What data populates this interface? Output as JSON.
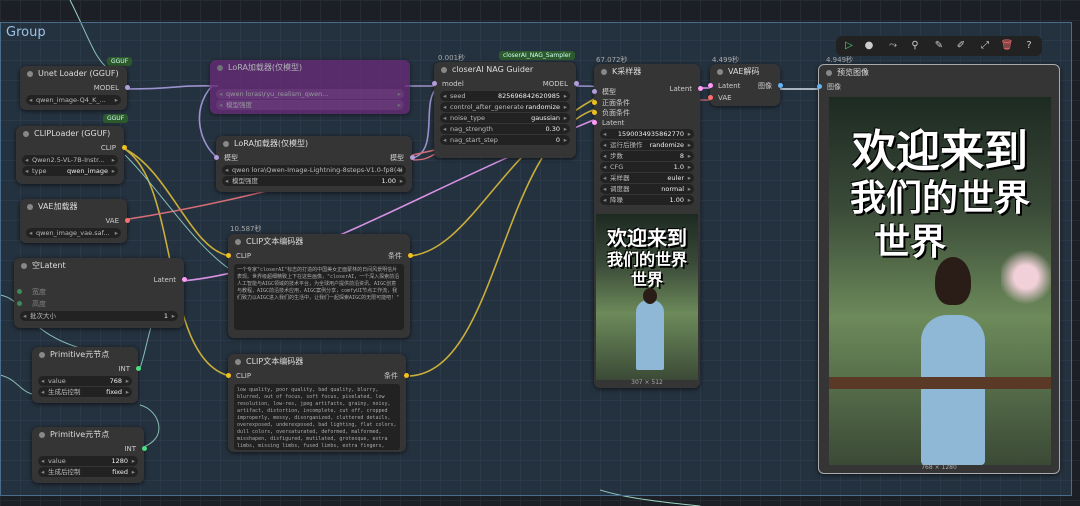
{
  "group": {
    "title": "Group"
  },
  "toolbar": {
    "icons": [
      "play-icon",
      "color-icon",
      "bypass-icon",
      "pin-icon",
      "edit-icon",
      "pen-icon",
      "fit-icon",
      "trash-icon",
      "help-icon"
    ]
  },
  "unet": {
    "badge": "GGUF",
    "title": "Unet Loader (GGUF)",
    "out": "MODEL",
    "value": "qwen_image-Q4_K_..."
  },
  "clip_loader": {
    "badge": "GGUF",
    "title": "CLIPLoader (GGUF)",
    "out": "CLIP",
    "value1": "Qwen2.5-VL-7B-Instr...",
    "type_label": "type",
    "type_value": "qwen_image"
  },
  "vae_loader": {
    "title": "VAE加载器",
    "out": "VAE",
    "value": "qwen_image_vae.saf..."
  },
  "latent": {
    "title": "空Latent",
    "out": "Latent",
    "w_label": "宽度",
    "h_label": "高度",
    "batch_label": "批次大小",
    "batch_value": "1"
  },
  "prim1": {
    "title": "Primitive元节点",
    "out": "INT",
    "value_label": "value",
    "value": "768",
    "ctrl_label": "生成后控制",
    "ctrl_value": "fixed"
  },
  "prim2": {
    "title": "Primitive元节点",
    "out": "INT",
    "value_label": "value",
    "value": "1280",
    "ctrl_label": "生成后控制",
    "ctrl_value": "fixed"
  },
  "lora_bypass": {
    "title": "LoRA加载器(仅模型)",
    "in": "模型",
    "out": "模型",
    "lora_value": "qwen lora\\Qwen-Image-Lightning-8steps-V1.0-fp8(4(2...",
    "strength_label": "模型强度",
    "strength_value": "1.00"
  },
  "lora_top": {
    "title": "LoRA加载器(仅模型)",
    "value": "qwen loras\\ryu_realism_qwen...",
    "label": "模型强度"
  },
  "clip_pos": {
    "time": "10.587秒",
    "title": "CLIP文本编码器",
    "in": "CLIP",
    "out": "条件",
    "text": "一个专家\"closerAI\"标志的打造的中国美女正面蒙林的日间风景明信片表现。世界级超细精致上下在这些画像，\"closerAI，一个深入探索前沿人工智能与AIGC领域的技术平台，为全球用户提供前沿资讯、AIGC创意与教程，AIGC前沿技术应用，AIGC案例分享，comfyUI节点工作流，我们致力以AIGC进入我们的生活中，让我们一起探索AIGC的无限可能吧！\""
  },
  "clip_neg": {
    "title": "CLIP文本编码器",
    "in": "CLIP",
    "out": "条件",
    "text": "low quality, poor quality, bad quality, blurry, blurred, out of focus, soft focus, pixelated, low resolution, low-res, jpeg artifacts, grainy, noisy, artifact, distortion, incomplete, cut off, cropped improperly, messy, disorganized, cluttered details, overexposed, underexposed, bad lighting, flat colors, dull colors, oversaturated, deformed, malformed, misshapen, disfigured, mutilated, grotesque, extra limbs, missing limbs, fused limbs, extra fingers, missing fingers, six fingers, mutated hands, deformed hands, bad anatomy"
  },
  "nag": {
    "time": "0.001秒",
    "badge": "closerAI_NAG_Sampler",
    "title": "closerAI NAG Guider",
    "in": "model",
    "out": "MODEL",
    "rows": [
      [
        "seed",
        "825696842620985"
      ],
      [
        "control_after_generate",
        "randomize"
      ],
      [
        "noise_type",
        "gaussian"
      ],
      [
        "nag_strength",
        "0.30"
      ],
      [
        "nag_start_step",
        "0"
      ]
    ]
  },
  "ksampler": {
    "time": "67.072秒",
    "title": "K采样器",
    "out": "Latent",
    "inputs": [
      "模型",
      "正面条件",
      "负面条件",
      "Latent"
    ],
    "rows": [
      [
        "",
        "1590034935862770"
      ],
      [
        "运行后操作",
        "randomize"
      ],
      [
        "步数",
        "8"
      ],
      [
        "CFG",
        "1.0"
      ],
      [
        "采样器",
        "euler"
      ],
      [
        "调度器",
        "normal"
      ],
      [
        "降噪",
        "1.00"
      ]
    ],
    "size": "307 × 512"
  },
  "vae_decode": {
    "time": "4.499秒",
    "title": "VAE解码",
    "in1": "Latent",
    "in2": "VAE",
    "out": "图像"
  },
  "preview": {
    "time": "4.949秒",
    "title": "预览图像",
    "in": "图像",
    "size": "768 × 1280",
    "poster_line1": "欢迎来到",
    "poster_line2": "我们的世界",
    "poster_line3": "世界"
  },
  "colors": {
    "accent": "#9ec3e6",
    "clip_wire": "#f0c020",
    "model_wire": "#b39ddb",
    "vae_wire": "#ff6e6e",
    "latent_wire": "#ff9cf9"
  }
}
